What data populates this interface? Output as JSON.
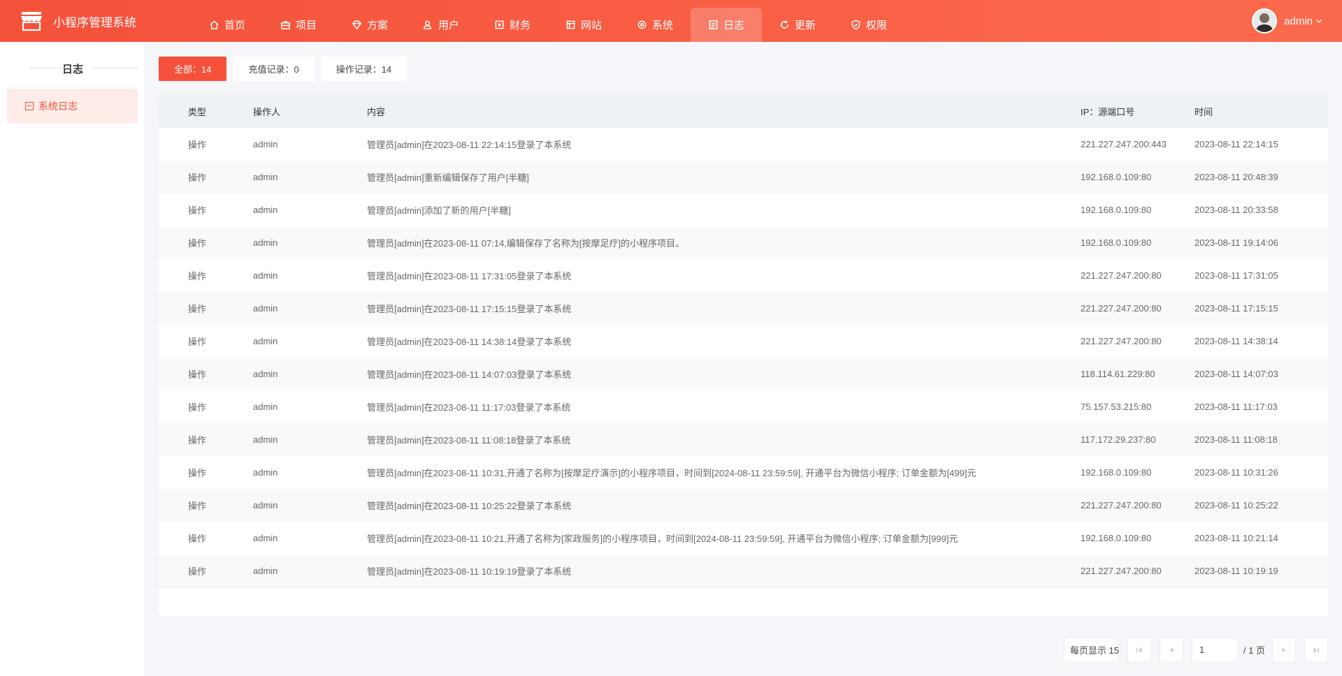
{
  "app": {
    "title": "小程序管理系统"
  },
  "nav": [
    {
      "label": "首页",
      "icon": "home-icon"
    },
    {
      "label": "项目",
      "icon": "briefcase-icon"
    },
    {
      "label": "方案",
      "icon": "diamond-icon"
    },
    {
      "label": "用户",
      "icon": "users-icon"
    },
    {
      "label": "财务",
      "icon": "finance-icon"
    },
    {
      "label": "网站",
      "icon": "website-icon"
    },
    {
      "label": "系统",
      "icon": "gear-icon"
    },
    {
      "label": "日志",
      "icon": "log-icon",
      "active": true
    },
    {
      "label": "更新",
      "icon": "refresh-icon"
    },
    {
      "label": "权限",
      "icon": "shield-icon"
    }
  ],
  "user": {
    "name": "admin"
  },
  "sidebar": {
    "title": "日志",
    "items": [
      {
        "label": "系统日志",
        "active": true
      }
    ]
  },
  "filters": [
    {
      "label": "全部：14",
      "active": true
    },
    {
      "label": "充值记录：0"
    },
    {
      "label": "操作记录：14"
    }
  ],
  "table": {
    "headers": {
      "type": "类型",
      "operator": "操作人",
      "content": "内容",
      "ip": "IP：源端口号",
      "time": "时间"
    },
    "rows": [
      {
        "type": "操作",
        "operator": "admin",
        "content": "管理员[admin]在2023-08-11 22:14:15登录了本系统",
        "ip": "221.227.247.200:443",
        "time": "2023-08-11 22:14:15"
      },
      {
        "type": "操作",
        "operator": "admin",
        "content": "管理员[admin]重新编辑保存了用户[半糖]",
        "ip": "192.168.0.109:80",
        "time": "2023-08-11 20:48:39"
      },
      {
        "type": "操作",
        "operator": "admin",
        "content": "管理员[admin]添加了新的用户[半糖]",
        "ip": "192.168.0.109:80",
        "time": "2023-08-11 20:33:58"
      },
      {
        "type": "操作",
        "operator": "admin",
        "content": "管理员[admin]在2023-08-11 07:14,编辑保存了名称为[按摩足疗]的小程序项目。",
        "ip": "192.168.0.109:80",
        "time": "2023-08-11 19:14:06"
      },
      {
        "type": "操作",
        "operator": "admin",
        "content": "管理员[admin]在2023-08-11 17:31:05登录了本系统",
        "ip": "221.227.247.200:80",
        "time": "2023-08-11 17:31:05"
      },
      {
        "type": "操作",
        "operator": "admin",
        "content": "管理员[admin]在2023-08-11 17:15:15登录了本系统",
        "ip": "221.227.247.200:80",
        "time": "2023-08-11 17:15:15"
      },
      {
        "type": "操作",
        "operator": "admin",
        "content": "管理员[admin]在2023-08-11 14:38:14登录了本系统",
        "ip": "221.227.247.200:80",
        "time": "2023-08-11 14:38:14"
      },
      {
        "type": "操作",
        "operator": "admin",
        "content": "管理员[admin]在2023-08-11 14:07:03登录了本系统",
        "ip": "118.114.61.229:80",
        "time": "2023-08-11 14:07:03"
      },
      {
        "type": "操作",
        "operator": "admin",
        "content": "管理员[admin]在2023-08-11 11:17:03登录了本系统",
        "ip": "75.157.53.215:80",
        "time": "2023-08-11 11:17:03"
      },
      {
        "type": "操作",
        "operator": "admin",
        "content": "管理员[admin]在2023-08-11 11:08:18登录了本系统",
        "ip": "117.172.29.237:80",
        "time": "2023-08-11 11:08:18"
      },
      {
        "type": "操作",
        "operator": "admin",
        "content": "管理员[admin]在2023-08-11 10:31,开通了名称为[按摩足疗演示]的小程序项目，时间到[2024-08-11 23:59:59], 开通平台为微信小程序; 订单金额为[499]元",
        "ip": "192.168.0.109:80",
        "time": "2023-08-11 10:31:26"
      },
      {
        "type": "操作",
        "operator": "admin",
        "content": "管理员[admin]在2023-08-11 10:25:22登录了本系统",
        "ip": "221.227.247.200:80",
        "time": "2023-08-11 10:25:22"
      },
      {
        "type": "操作",
        "operator": "admin",
        "content": "管理员[admin]在2023-08-11 10:21,开通了名称为[家政服务]的小程序项目，时间到[2024-08-11 23:59:59], 开通平台为微信小程序; 订单金额为[999]元",
        "ip": "192.168.0.109:80",
        "time": "2023-08-11 10:21:14"
      },
      {
        "type": "操作",
        "operator": "admin",
        "content": "管理员[admin]在2023-08-11 10:19:19登录了本系统",
        "ip": "221.227.247.200:80",
        "time": "2023-08-11 10:19:19"
      }
    ]
  },
  "pagination": {
    "page_size_label": "每页显示 15",
    "current_page": "1",
    "total_label": "/ 1 页"
  },
  "colors": {
    "primary": "#f5513a",
    "active_bg": "#fdece8"
  }
}
